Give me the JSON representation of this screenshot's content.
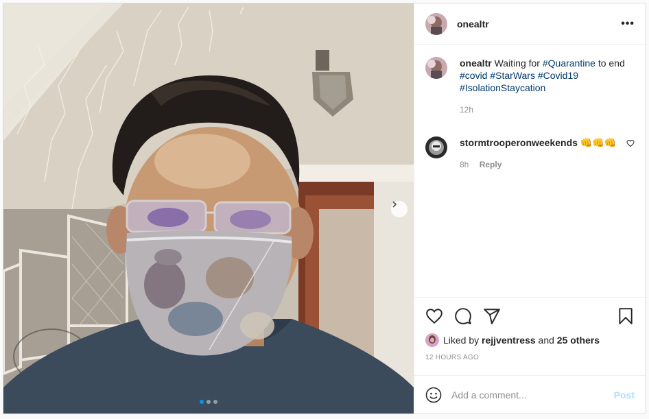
{
  "post": {
    "username": "onealtr",
    "more_icon": "more-horizontal-icon",
    "caption": {
      "username": "onealtr",
      "text": "Waiting for",
      "hashtags": [
        "#Quarantine",
        "to end",
        "#covid",
        "#StarWars",
        "#Covid19",
        "#IsolationStaycation"
      ],
      "age": "12h"
    },
    "comments": [
      {
        "username": "stormtrooperonweekends",
        "text": "👊👊👊",
        "age": "8h",
        "reply_label": "Reply"
      }
    ],
    "likes": {
      "prefix": "Liked by",
      "user": "rejjventress",
      "middle": "and",
      "others": "25 others"
    },
    "timestamp": "12 HOURS AGO",
    "add_comment": {
      "placeholder": "Add a comment...",
      "post_label": "Post"
    },
    "carousel": {
      "total": 3,
      "active_index": 0
    },
    "colors": {
      "link": "#00376b",
      "active_dot": "#0095f6",
      "post_button_disabled": "#b2dffc",
      "secondary_text": "#8e8e8e"
    }
  }
}
